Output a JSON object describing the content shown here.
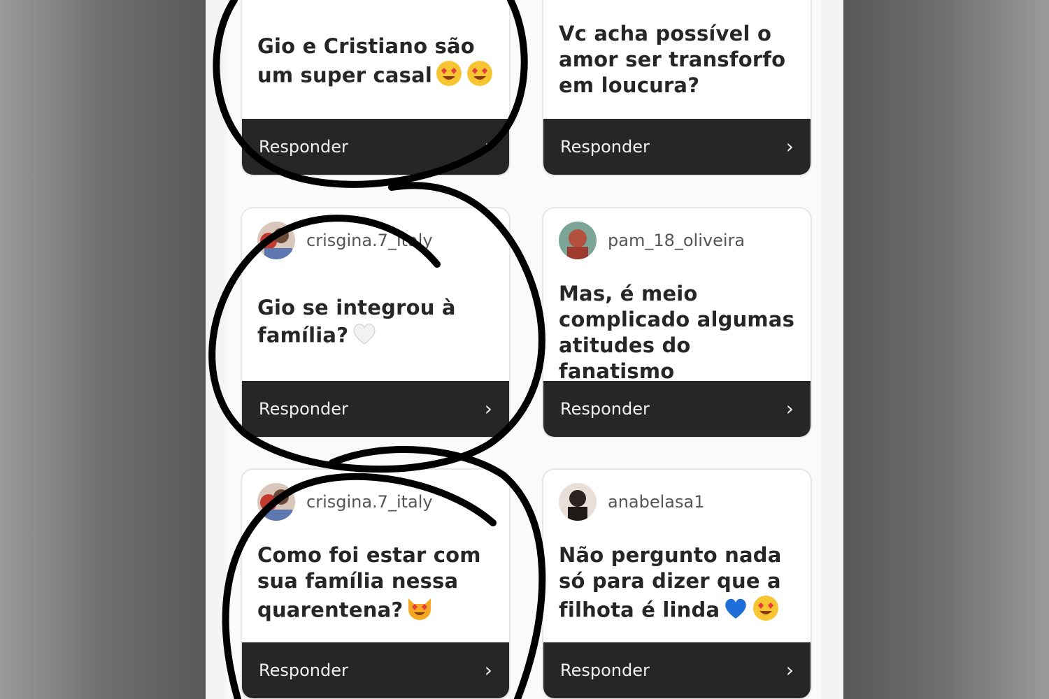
{
  "cards": [
    {
      "username": "",
      "question": "Gio e Cristiano são um super casal",
      "emojis": [
        "heart-eyes-emoji",
        "heart-eyes-emoji"
      ],
      "reply_label": "Responder"
    },
    {
      "username": "",
      "question": "Vc acha possível o amor ser transforfo em loucura?",
      "emojis": [],
      "reply_label": "Responder"
    },
    {
      "username": "crisgina.7_italy",
      "question": "Gio se integrou à família?",
      "emojis": [
        "white-heart-emoji"
      ],
      "reply_label": "Responder"
    },
    {
      "username": "pam_18_oliveira",
      "question": "Mas, é meio complicado algumas atitudes do fanatismo",
      "emojis": [],
      "reply_label": "Responder"
    },
    {
      "username": "crisgina.7_italy",
      "question": "Como foi estar com sua família nessa quarentena?",
      "emojis": [
        "heart-eyes-cat-emoji"
      ],
      "reply_label": "Responder"
    },
    {
      "username": "anabelasa1",
      "question": "Não pergunto nada só para dizer que a filhota é linda",
      "emojis": [
        "blue-heart-emoji",
        "heart-eyes-emoji"
      ],
      "reply_label": "Responder"
    }
  ],
  "icons": {
    "reply": "chevron-right-icon"
  },
  "colors": {
    "reply_bar": "#262626",
    "card_bg": "#ffffff",
    "annotation": "#000000"
  }
}
